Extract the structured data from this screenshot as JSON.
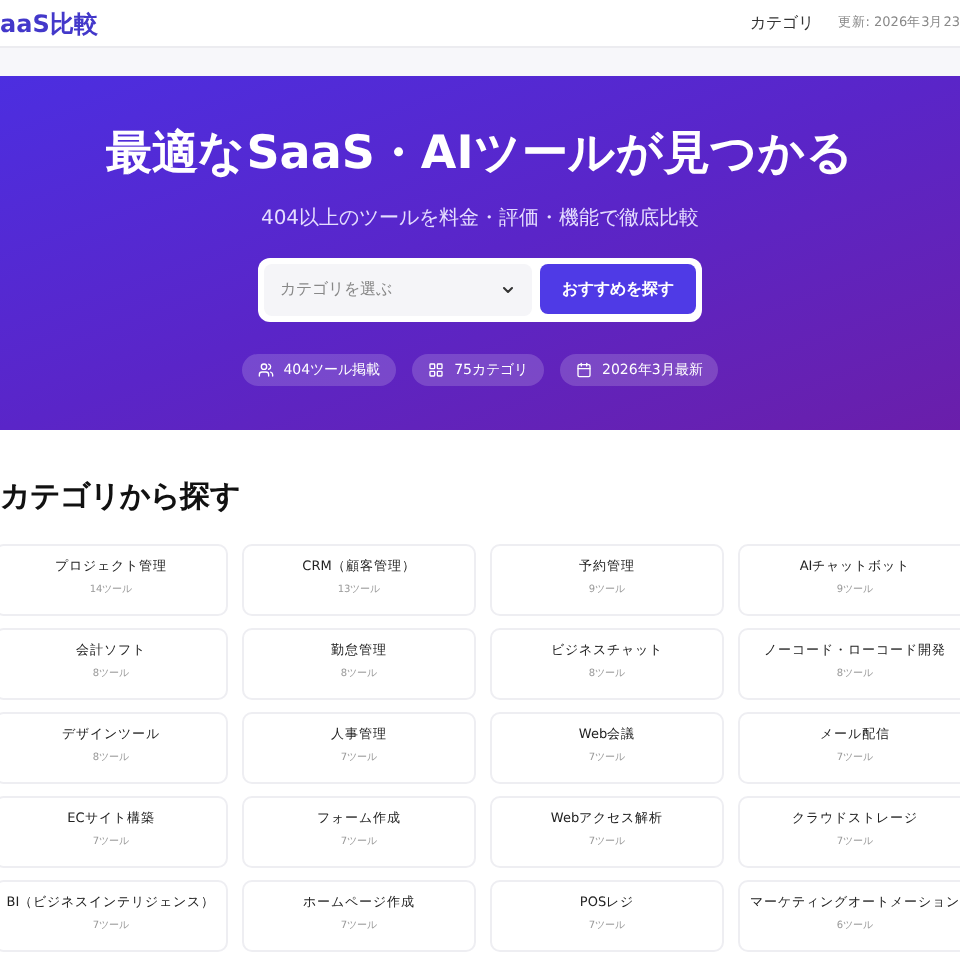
{
  "header": {
    "logo": "aaS比較",
    "nav_link": "カテゴリ",
    "updated": "更新: 2026年3月23"
  },
  "hero": {
    "title": "最適なSaaS・AIツールが見つかる",
    "subtitle": "404以上のツールを料金・評価・機能で徹底比較",
    "select": {
      "placeholder": "カテゴリを選ぶ"
    },
    "button": "おすすめを探す",
    "stats": [
      {
        "kind": "tools",
        "label": "404ツール掲載"
      },
      {
        "kind": "categories",
        "label": "75カテゴリ"
      },
      {
        "kind": "date",
        "label": "2026年3月最新"
      }
    ]
  },
  "categories_section": {
    "title": "カテゴリから探す",
    "items": [
      {
        "name": "プロジェクト管理",
        "count": "14ツール"
      },
      {
        "name": "CRM（顧客管理）",
        "count": "13ツール"
      },
      {
        "name": "予約管理",
        "count": "9ツール"
      },
      {
        "name": "AIチャットボット",
        "count": "9ツール"
      },
      {
        "name": "会計ソフト",
        "count": "8ツール"
      },
      {
        "name": "勤怠管理",
        "count": "8ツール"
      },
      {
        "name": "ビジネスチャット",
        "count": "8ツール"
      },
      {
        "name": "ノーコード・ローコード開発",
        "count": "8ツール"
      },
      {
        "name": "デザインツール",
        "count": "8ツール"
      },
      {
        "name": "人事管理",
        "count": "7ツール"
      },
      {
        "name": "Web会議",
        "count": "7ツール"
      },
      {
        "name": "メール配信",
        "count": "7ツール"
      },
      {
        "name": "ECサイト構築",
        "count": "7ツール"
      },
      {
        "name": "フォーム作成",
        "count": "7ツール"
      },
      {
        "name": "Webアクセス解析",
        "count": "7ツール"
      },
      {
        "name": "クラウドストレージ",
        "count": "7ツール"
      },
      {
        "name": "BI（ビジネスインテリジェンス）",
        "count": "7ツール"
      },
      {
        "name": "ホームページ作成",
        "count": "7ツール"
      },
      {
        "name": "POSレジ",
        "count": "7ツール"
      },
      {
        "name": "マーケティングオートメーション",
        "count": "6ツール"
      }
    ]
  }
}
